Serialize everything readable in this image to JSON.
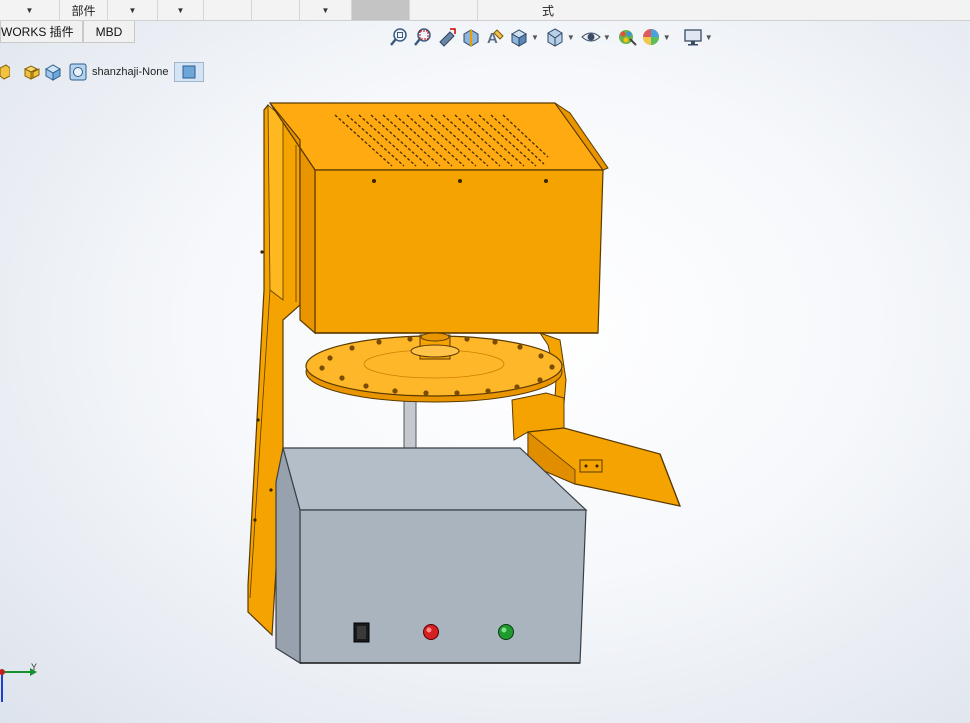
{
  "top_strip": {
    "menu_label": "部件",
    "mode_label": "式"
  },
  "tabs": [
    {
      "label": "WORKS 插件"
    },
    {
      "label": "MBD"
    }
  ],
  "view_toolbar": {
    "icons": [
      "zoom-to-fit-icon",
      "zoom-to-area-icon",
      "previous-view-icon",
      "section-view-icon",
      "dynamic-annotation-icon",
      "view-orientation-icon",
      "display-style-icon",
      "hide-show-items-icon",
      "edit-appearance-icon",
      "apply-scene-icon",
      "view-settings-icon"
    ]
  },
  "feature_tree": {
    "model_name": "shanzhaji-None"
  },
  "colors": {
    "housing_orange": "#f5a300",
    "base_gray": "#a9b4bf",
    "red_lamp": "#d42020",
    "green_lamp": "#1e9a2e"
  },
  "triad": {
    "y_axis_label": "Y"
  }
}
